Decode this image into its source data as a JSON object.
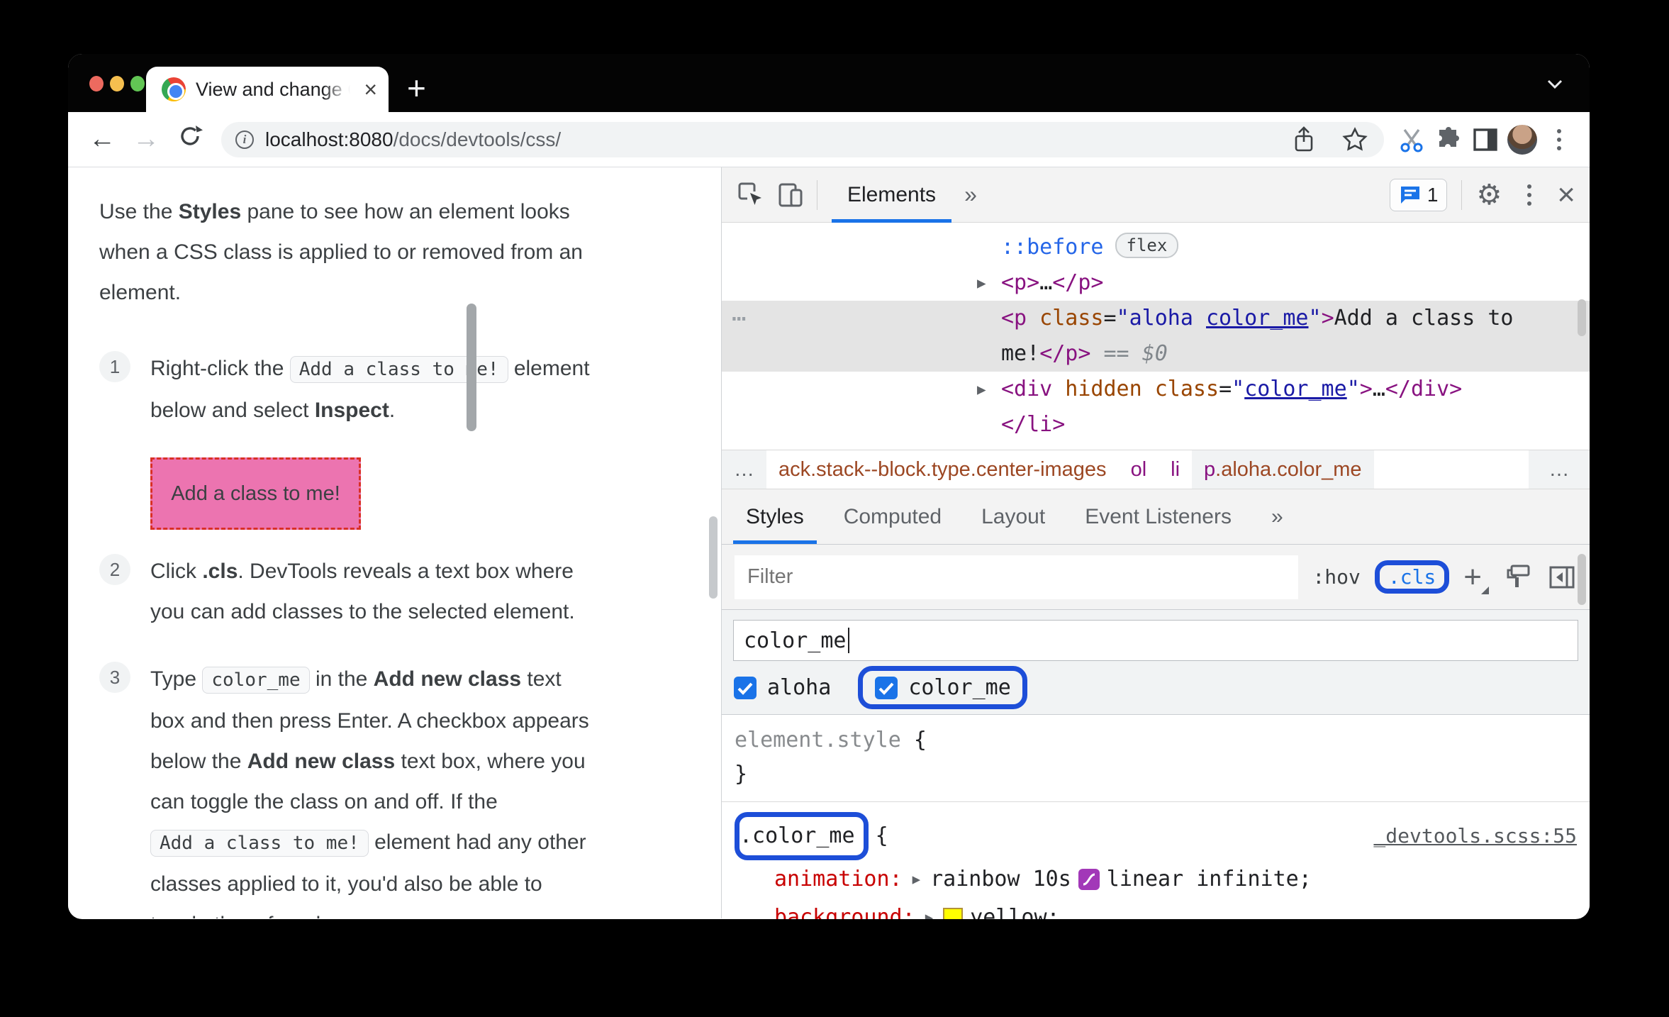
{
  "browser": {
    "tab_title": "View and change CSS - Chrome",
    "new_tab_label": "+",
    "tab_close": "×",
    "url": {
      "host": "localhost:8080",
      "path": "/docs/devtools/css/"
    }
  },
  "article": {
    "intro": [
      {
        "t": "Use the ",
        "s": "plain"
      },
      {
        "t": "Styles",
        "s": "bold"
      },
      {
        "t": " pane to see how an element looks when a CSS class is applied to or removed from an element.",
        "s": "plain"
      }
    ],
    "steps": [
      {
        "num": "1",
        "segments": [
          {
            "t": "Right-click the ",
            "s": "plain"
          },
          {
            "t": "Add a class to me!",
            "s": "code"
          },
          {
            "t": " element below and select ",
            "s": "plain"
          },
          {
            "t": "Inspect",
            "s": "bold"
          },
          {
            "t": ".",
            "s": "plain"
          }
        ]
      },
      {
        "num": "2",
        "segments": [
          {
            "t": "Click ",
            "s": "plain"
          },
          {
            "t": ".cls",
            "s": "bold"
          },
          {
            "t": ". DevTools reveals a text box where you can add classes to the selected element.",
            "s": "plain"
          }
        ]
      },
      {
        "num": "3",
        "segments": [
          {
            "t": "Type ",
            "s": "plain"
          },
          {
            "t": "color_me",
            "s": "code"
          },
          {
            "t": " in the ",
            "s": "plain"
          },
          {
            "t": "Add new class",
            "s": "bold"
          },
          {
            "t": " text box and then press Enter. A checkbox appears below the ",
            "s": "plain"
          },
          {
            "t": "Add new class",
            "s": "bold"
          },
          {
            "t": " text box, where you can toggle the class on and off. If the ",
            "s": "plain"
          },
          {
            "t": "Add a class to me!",
            "s": "code"
          },
          {
            "t": " element had any other classes applied to it, you'd also be able to toggle them from here.",
            "s": "plain"
          }
        ]
      }
    ],
    "demo_box_label": "Add a class to me!"
  },
  "devtools": {
    "toolbar": {
      "tab": "Elements",
      "more": "»",
      "badge_count": "1",
      "close": "×",
      "gear": "⚙"
    },
    "dom_tree": {
      "gutter_dots": "…",
      "lines": {
        "pseudo": [
          {
            "t": "::before",
            "s": "pseudo"
          },
          {
            "t": "flex",
            "s": "badge"
          }
        ],
        "p_collapsed": [
          {
            "t": "▶",
            "s": "arrow"
          },
          {
            "t": "<p>",
            "s": "tag"
          },
          {
            "t": "…",
            "s": "ellipsis"
          },
          {
            "t": "</p>",
            "s": "tag"
          }
        ],
        "p_selected": [
          {
            "t": "<p",
            "s": "tag"
          },
          {
            "t": " class",
            "s": "attr"
          },
          {
            "t": "=",
            "s": "punct"
          },
          {
            "t": "\"aloha ",
            "s": "val"
          },
          {
            "t": "color_me",
            "s": "val-u"
          },
          {
            "t": "\"",
            "s": "val"
          },
          {
            "t": ">",
            "s": "tag"
          },
          {
            "t": "Add a class to me!",
            "s": "text"
          },
          {
            "t": "</p>",
            "s": "tag"
          },
          {
            "t": " == ",
            "s": "meta"
          },
          {
            "t": "$0",
            "s": "meta-i"
          }
        ],
        "div_hidden": [
          {
            "t": "▶",
            "s": "arrow"
          },
          {
            "t": "<div",
            "s": "tag"
          },
          {
            "t": " hidden class",
            "s": "attr"
          },
          {
            "t": "=",
            "s": "punct"
          },
          {
            "t": "\"",
            "s": "val"
          },
          {
            "t": "color_me",
            "s": "val-u"
          },
          {
            "t": "\"",
            "s": "val"
          },
          {
            "t": ">",
            "s": "tag"
          },
          {
            "t": "…",
            "s": "ellipsis"
          },
          {
            "t": "</div>",
            "s": "tag"
          }
        ],
        "li_close": [
          {
            "t": "</li>",
            "s": "tag"
          }
        ]
      }
    },
    "breadcrumbs": {
      "more_left": "…",
      "chain": "ack.stack--block.type.center-images",
      "ol": "ol",
      "li": "li",
      "sel_tag": "p",
      "sel_classes": ".aloha.color_me",
      "more_right": "…"
    },
    "style_tabs": {
      "tabs": [
        "Styles",
        "Computed",
        "Layout",
        "Event Listeners"
      ],
      "more": "»"
    },
    "filter_row": {
      "placeholder": "Filter",
      "hov": ":hov",
      "cls": ".cls",
      "plus": "+"
    },
    "new_class": {
      "value": "color_me"
    },
    "class_toggles": [
      {
        "label": "aloha"
      },
      {
        "label": "color_me"
      }
    ],
    "styles_pane": {
      "expand_arrow": "▶",
      "element_style": {
        "selector": "element.style",
        "open": " {",
        "close": "}"
      },
      "color_me_rule": {
        "selector": ".color_me",
        "open": "{",
        "source": "_devtools.scss:55",
        "props": [
          {
            "name": "animation:",
            "value_pre": "rainbow 10s",
            "value_post": "linear infinite;"
          },
          {
            "name": "background:",
            "value_pre": "",
            "value_post": "yellow;"
          }
        ],
        "close": "}"
      }
    }
  }
}
